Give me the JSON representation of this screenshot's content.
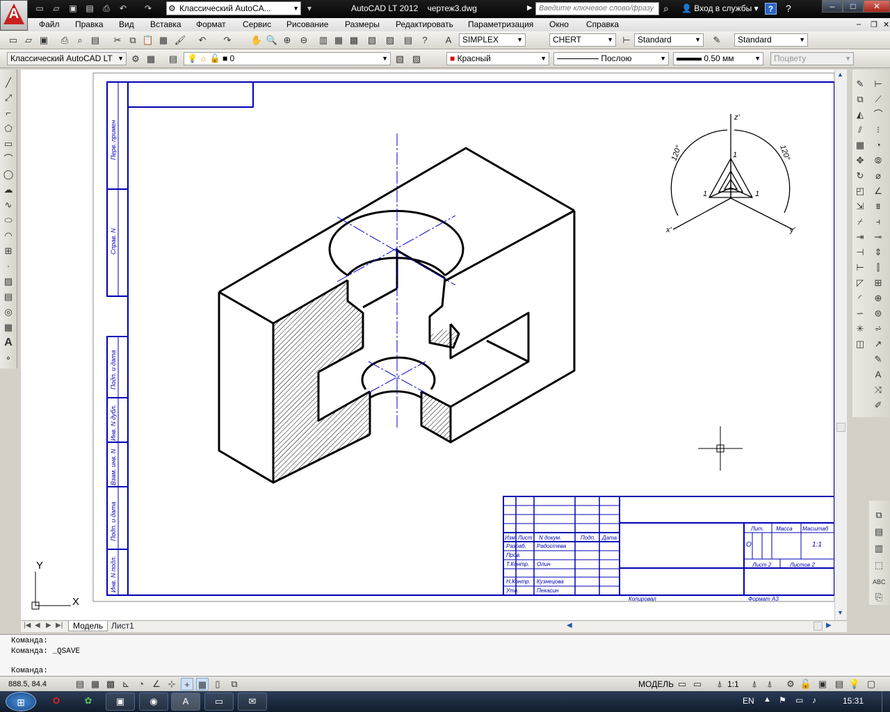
{
  "titlebar": {
    "workspace": "Классический AutoCA...",
    "app_name": "AutoCAD LT 2012",
    "file_name": "чертеж3.dwg",
    "search_placeholder": "Введите ключевое слово/фразу",
    "signin": "Вход в службы"
  },
  "menu": [
    "Файл",
    "Правка",
    "Вид",
    "Вставка",
    "Формат",
    "Сервис",
    "Рисование",
    "Размеры",
    "Редактировать",
    "Параметризация",
    "Окно",
    "Справка"
  ],
  "styles": {
    "text_style": "SIMPLEX",
    "text_font": "CHERT",
    "dim_style": "Standard",
    "table_style": "Standard"
  },
  "layers": {
    "workspace": "Классический AutoCAD LT",
    "layer": "0",
    "color": "Красный",
    "linetype": "Послою",
    "lineweight": "0.50 мм",
    "plotstyle": "Поцвету"
  },
  "drawing": {
    "side_labels": [
      "Перв. примен",
      "Справ. N",
      "Подп. и дата",
      "Инв. N дубл.",
      "Взам. инв. N",
      "Подп. и дата",
      "Инв. N подл."
    ],
    "axes": {
      "z": "z'",
      "x": "x'",
      "y": "y'",
      "angle_left": "120°",
      "angle_right": "120°",
      "one": "1"
    },
    "stamp": {
      "headers": [
        "Изм",
        "Лист",
        "N докум.",
        "Подп.",
        "Дата"
      ],
      "rows": [
        [
          "Разраб.",
          "Радостева"
        ],
        [
          "Пров.",
          ""
        ],
        [
          "Т.Контр.",
          "Олин"
        ],
        [
          "Н.Контр.",
          "Кузнецова"
        ],
        [
          "Утв.",
          "Пекасин"
        ]
      ],
      "lit": "Лит.",
      "mass": "Масса",
      "scale_hdr": "Масштаб",
      "scale": "1:1",
      "sheet": "Лист 2",
      "sheets": "Листов 2",
      "copied": "Копировал",
      "format": "Формат А3",
      "lit_val": "О"
    },
    "ucs_x": "X",
    "ucs_y": "Y"
  },
  "tabs": [
    "Модель",
    "Лист1"
  ],
  "command": {
    "line1": "Команда:",
    "line2": "Команда:  _QSAVE",
    "prompt": "Команда:"
  },
  "status": {
    "coords": "888.5, 84.4",
    "model": "МОДЕЛЬ",
    "scale": "1:1"
  },
  "taskbar": {
    "lang": "EN",
    "time": "15:31"
  },
  "colors": {
    "drawing_blue": "#0000b4",
    "layer_color": "#e00000"
  }
}
